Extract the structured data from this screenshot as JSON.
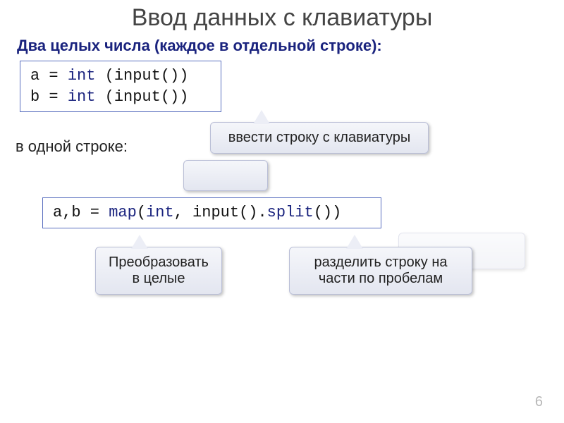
{
  "title": "Ввод данных с клавиатуры",
  "subtitle": "Два целых числа (каждое в отдельной строке):",
  "code1": {
    "line1a": "a = ",
    "line1b": "int",
    "line1c": " (input())",
    "line2a": "b = ",
    "line2b": "int",
    "line2c": " (input())"
  },
  "inline_label": "в одной строке:",
  "code2": {
    "part1": "a,b = ",
    "part2": "map",
    "part3": "(",
    "part4": "int",
    "part5": ", input().",
    "part6": "split",
    "part7": "())"
  },
  "callout_input": "ввести строку с клавиатуры",
  "callout_convert": "Преобразовать в целые",
  "callout_split": "разделить строку на части по пробелам",
  "page_number": "6"
}
